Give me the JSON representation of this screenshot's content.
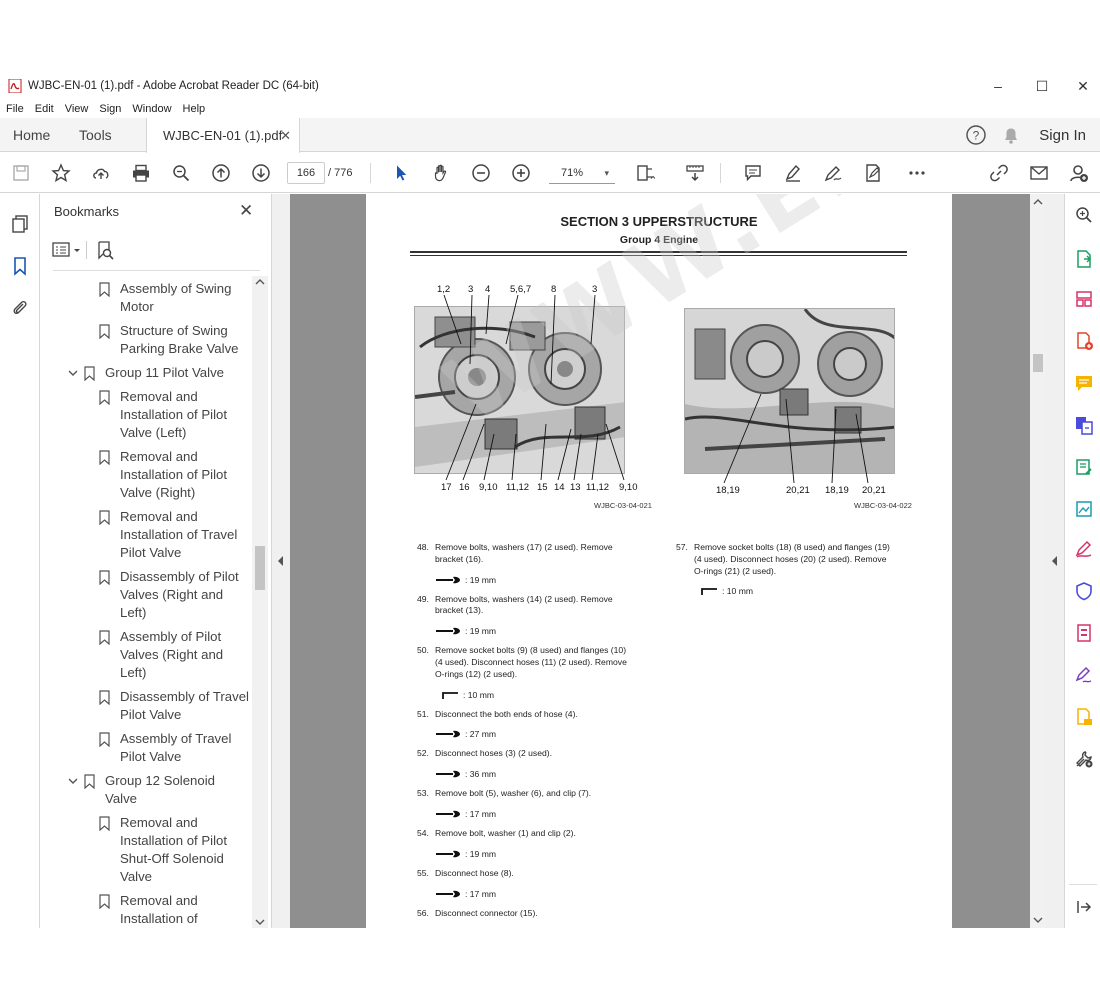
{
  "window": {
    "title": "WJBC-EN-01 (1).pdf - Adobe Acrobat Reader DC (64-bit)",
    "controls": {
      "minimize": "–",
      "maximize": "☐",
      "close": "✕"
    }
  },
  "menu": [
    "File",
    "Edit",
    "View",
    "Sign",
    "Window",
    "Help"
  ],
  "tabs": {
    "home": "Home",
    "tools": "Tools",
    "document": "WJBC-EN-01 (1).pdf",
    "close": "✕",
    "sign_in": "Sign In"
  },
  "toolbar": {
    "page_current": "166",
    "page_total": "/ 776",
    "zoom": "71%",
    "zoom_caret": "▾"
  },
  "bookmarks": {
    "title": "Bookmarks",
    "close": "✕",
    "items": [
      {
        "label": "Assembly of Swing\nMotor",
        "level": 2
      },
      {
        "label": "Structure of Swing\nParking Brake Valve",
        "level": 2
      },
      {
        "label": "Group 11 Pilot Valve",
        "level": 1
      },
      {
        "label": "Removal and\nInstallation of Pilot\nValve (Left)",
        "level": 2
      },
      {
        "label": "Removal and\nInstallation of Pilot\nValve (Right)",
        "level": 2
      },
      {
        "label": "Removal and\nInstallation of Travel\nPilot Valve",
        "level": 2
      },
      {
        "label": "Disassembly of Pilot\nValves (Right and\nLeft)",
        "level": 2
      },
      {
        "label": "Assembly of Pilot\nValves (Right and\nLeft)",
        "level": 2
      },
      {
        "label": "Disassembly of Travel\nPilot Valve",
        "level": 2
      },
      {
        "label": "Assembly of Travel\nPilot Valve",
        "level": 2
      },
      {
        "label": "Group 12 Solenoid\nValve",
        "level": 1
      },
      {
        "label": "Removal and\nInstallation of Pilot\nShut-Off Solenoid\nValve",
        "level": 2
      },
      {
        "label": "Removal and\nInstallation of",
        "level": 2
      }
    ]
  },
  "page": {
    "section": "SECTION 3 UPPERSTRUCTURE",
    "group": "Group 4 Engine",
    "watermark": "WWW.EPCATALOG.COM",
    "fig1": {
      "id": "WJBC-03-04-021",
      "top_callouts": [
        "1,2",
        "3",
        "4",
        "5,6,7",
        "8",
        "3"
      ],
      "bottom_callouts": [
        "17",
        "16",
        "9,10",
        "11,12",
        "15",
        "14",
        "13",
        "11,12",
        "9,10"
      ]
    },
    "fig2": {
      "id": "WJBC-03-04-022",
      "bottom_callouts": [
        "18,19",
        "20,21",
        "18,19",
        "20,21"
      ]
    },
    "steps_left": [
      {
        "num": "48.",
        "text": "Remove bolts, washers (17) (2 used). Remove\nbracket (16).",
        "tool": ": 19 mm"
      },
      {
        "num": "49.",
        "text": "Remove bolts, washers (14) (2 used). Remove\nbracket (13).",
        "tool": ": 19 mm"
      },
      {
        "num": "50.",
        "text": "Remove socket bolts (9) (8 used) and flanges (10)\n(4 used). Disconnect hoses (11) (2 used). Remove\nO-rings (12) (2 used).",
        "tool": ": 10 mm"
      },
      {
        "num": "51.",
        "text": "Disconnect the both ends of hose (4).",
        "tool": ": 27 mm"
      },
      {
        "num": "52.",
        "text": "Disconnect hoses (3) (2 used).",
        "tool": ": 36 mm"
      },
      {
        "num": "53.",
        "text": "Remove bolt (5), washer (6), and clip (7).",
        "tool": ": 17 mm"
      },
      {
        "num": "54.",
        "text": "Remove bolt, washer (1) and clip (2).",
        "tool": ": 19 mm"
      },
      {
        "num": "55.",
        "text": "Disconnect hose (8).",
        "tool": ": 17 mm"
      },
      {
        "num": "56.",
        "text": "Disconnect connector (15).",
        "tool": ""
      }
    ],
    "steps_right": [
      {
        "num": "57.",
        "text": "Remove socket bolts (18) (8 used) and flanges (19)\n(4 used). Disconnect hoses (20) (2 used). Remove\nO-rings (21) (2 used).",
        "tool": ": 10 mm"
      }
    ]
  }
}
